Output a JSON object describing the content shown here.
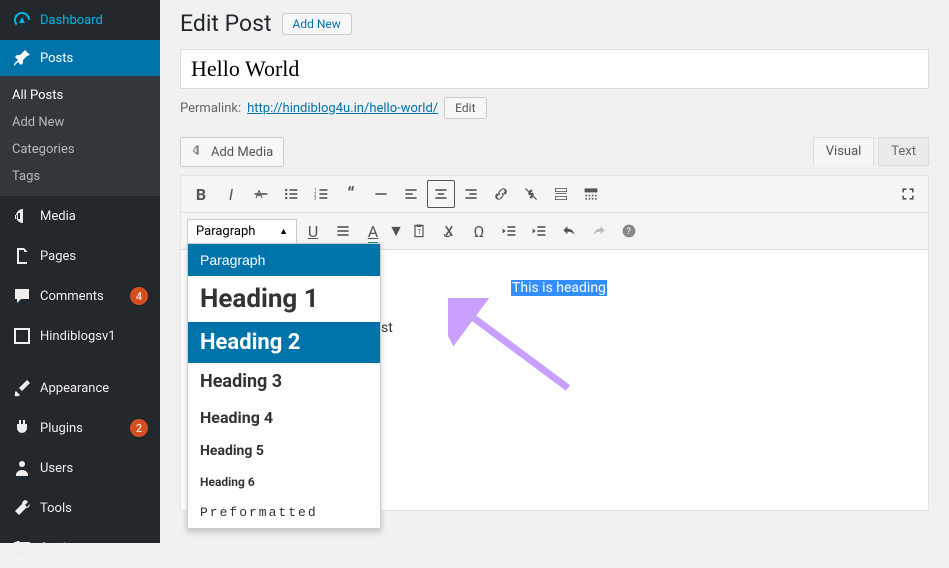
{
  "sidebar": {
    "dashboard": "Dashboard",
    "posts": "Posts",
    "submenu": {
      "all_posts": "All Posts",
      "add_new": "Add New",
      "categories": "Categories",
      "tags": "Tags"
    },
    "media": "Media",
    "pages": "Pages",
    "comments": "Comments",
    "comments_badge": "4",
    "hindiblogs": "Hindiblogsv1",
    "appearance": "Appearance",
    "plugins": "Plugins",
    "plugins_badge": "2",
    "users": "Users",
    "tools": "Tools",
    "settings": "Settings"
  },
  "header": {
    "title": "Edit Post",
    "add_new": "Add New"
  },
  "post": {
    "title_value": "Hello World",
    "permalink_label": "Permalink:",
    "permalink_url": "http://hindiblog4u.in/hello-world/",
    "edit_button": "Edit"
  },
  "editor": {
    "add_media": "Add Media",
    "tab_visual": "Visual",
    "tab_text": "Text",
    "format_label": "Paragraph",
    "dropdown": {
      "paragraph": "Paragraph",
      "h1": "Heading 1",
      "h2": "Heading 2",
      "h3": "Heading 3",
      "h4": "Heading 4",
      "h5": "Heading 5",
      "h6": "Heading 6",
      "pre": "Preformatted"
    },
    "content_heading": "This is heading",
    "peek": "st"
  }
}
